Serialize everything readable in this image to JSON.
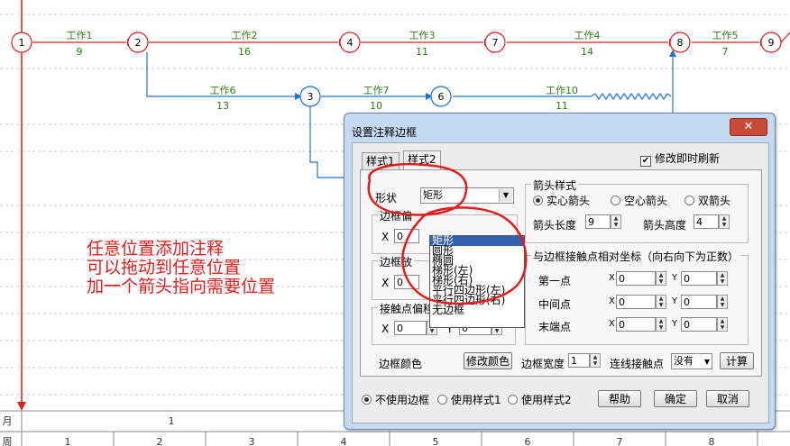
{
  "diagram": {
    "nodes": [
      "1",
      "2",
      "3",
      "4",
      "6",
      "7",
      "8",
      "9"
    ],
    "arrows": [
      {
        "name": "工作1",
        "duration": "9"
      },
      {
        "name": "工作2",
        "duration": "16"
      },
      {
        "name": "工作3",
        "duration": "11"
      },
      {
        "name": "工作4",
        "duration": "14"
      },
      {
        "name": "工作5",
        "duration": "7"
      },
      {
        "name": "工作6",
        "duration": "13"
      },
      {
        "name": "工作7",
        "duration": "10"
      },
      {
        "name": "工作10",
        "duration": "11"
      }
    ],
    "row_month_label": "月",
    "month_value": "1",
    "row_week_label": "周",
    "week_numbers": [
      "1",
      "2",
      "3",
      "4",
      "5",
      "6",
      "7",
      "8"
    ]
  },
  "annotation": {
    "lines": [
      "任意位置添加注释",
      "可以拖动到任意位置",
      "加一个箭头指向需要位置"
    ]
  },
  "dialog": {
    "title": "设置注释边框",
    "close_label": "✕",
    "refresh_checkbox": "修改即时刷新",
    "tabs": [
      "样式1",
      "样式2"
    ],
    "shape_label": "形状",
    "shape_value": "矩形",
    "shape_options": [
      "矩形",
      "圆形",
      "椭圆",
      "梯形(左)",
      "梯形(右)",
      "平行四边形(左)",
      "平行四边形(右)",
      "无边框"
    ],
    "border_offset_label": "边框偏",
    "border_zoom_label": "边框放",
    "x_label": "X",
    "y_label": "Y",
    "offset_x": "0",
    "zoom_x": "0",
    "contact_offset_label": "接触点偏移",
    "contact_x": "0",
    "contact_y": "0",
    "arrow_style_label": "箭头样式",
    "arrow_styles": [
      "实心箭头",
      "空心箭头",
      "双箭头"
    ],
    "arrow_length_label": "箭头长度",
    "arrow_length": "9",
    "arrow_height_label": "箭头高度",
    "arrow_height": "4",
    "relative_coords_label": "与边框接触点相对坐标（向右向下为正数）",
    "points": [
      {
        "label": "第一点",
        "x": "0",
        "y": "0"
      },
      {
        "label": "中间点",
        "x": "0",
        "y": "0"
      },
      {
        "label": "末端点",
        "x": "0",
        "y": "0"
      }
    ],
    "border_color_label": "边框颜色",
    "modify_color_button": "修改颜色",
    "border_width_label": "边框宽度",
    "border_width": "1",
    "connect_point_label": "连线接触点",
    "connect_point_value": "没有",
    "calc_button": "计算",
    "bottom_radios": [
      "不使用边框",
      "使用样式1",
      "使用样式2"
    ],
    "help_button": "帮助",
    "ok_button": "确定",
    "cancel_button": "取消"
  }
}
